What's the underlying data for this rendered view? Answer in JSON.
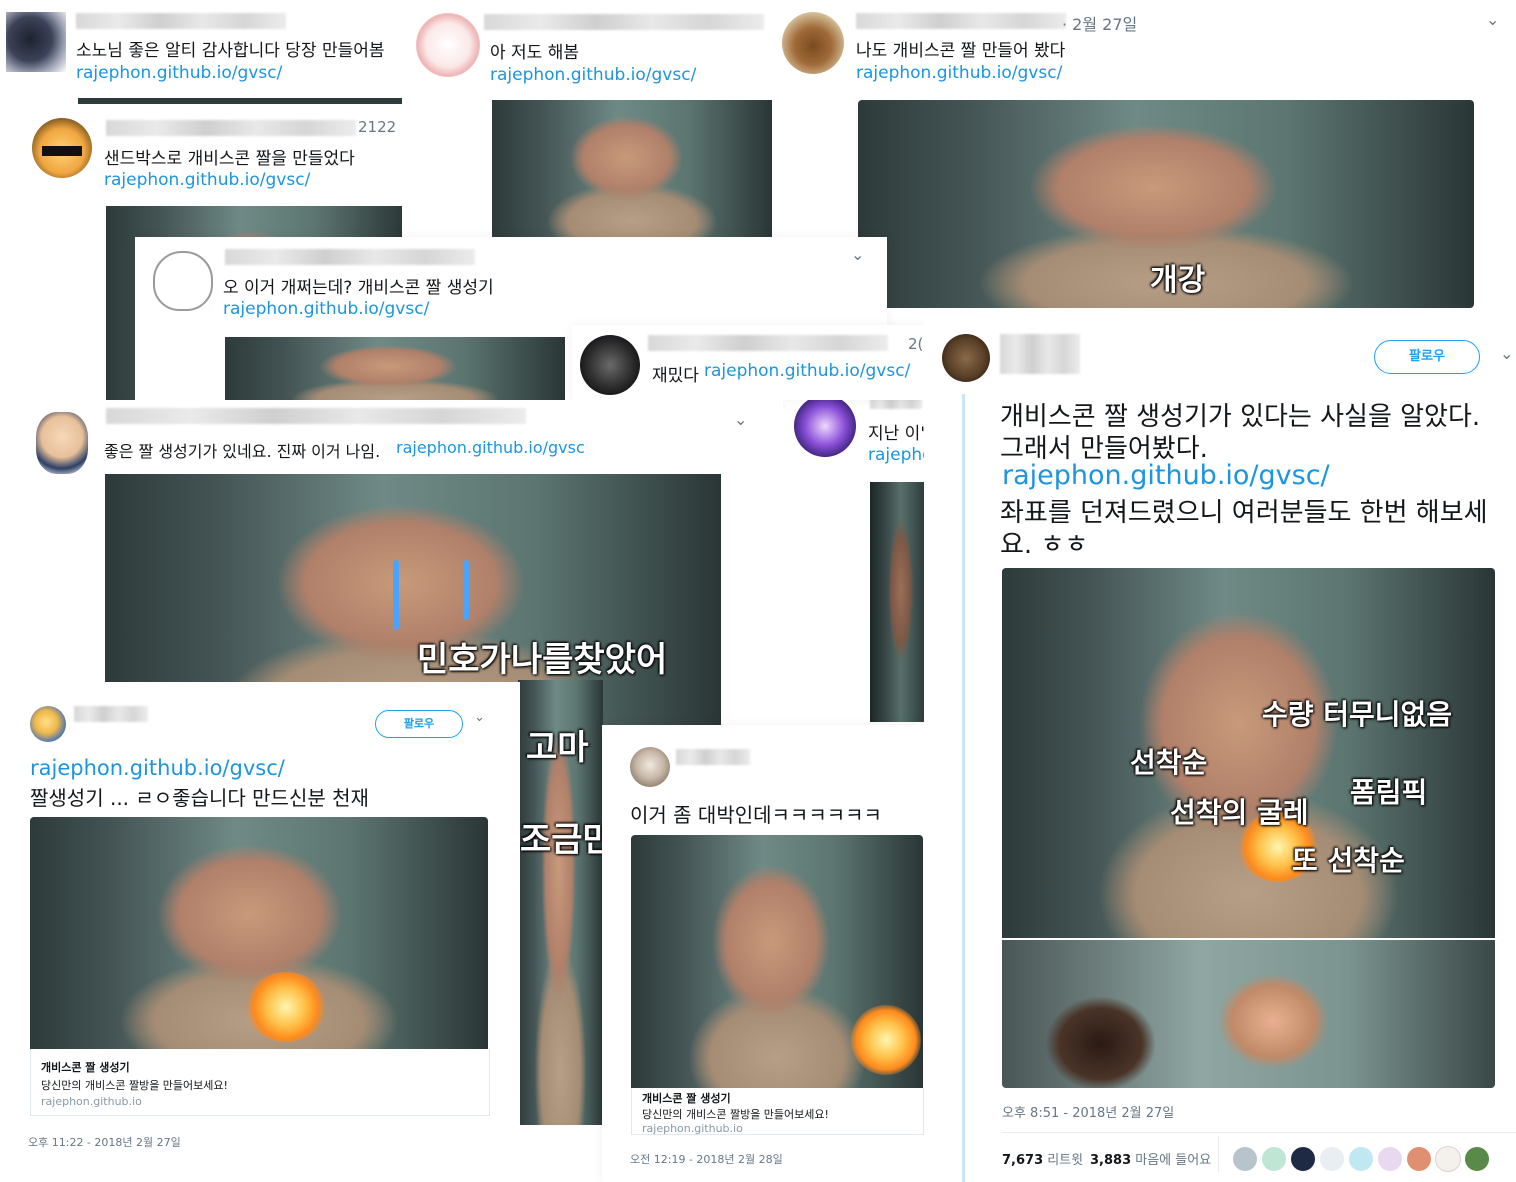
{
  "meta": {
    "colors": {
      "link": "#1b95e0",
      "follow": "#1da1f2",
      "text": "#14171a",
      "muted": "#657786"
    }
  },
  "t1": {
    "text": "소노님 좋은 알티 감사합니다 당장 만들어봄",
    "link": "rajephon.github.io/gvsc/"
  },
  "t2": {
    "text": "아 저도 해봄",
    "link": "rajephon.github.io/gvsc/"
  },
  "t3": {
    "date": "· 2월 27일",
    "text": "나도 개비스콘 짤 만들어 봤다",
    "link": "rajephon.github.io/gvsc/",
    "caption": "개강"
  },
  "t4": {
    "date": "2122",
    "text": "샌드박스로 개비스콘 짤을 만들었다",
    "link": "rajephon.github.io/gvsc/"
  },
  "t5": {
    "text": "오 이거 개쩌는데? 개비스콘 짤 생성기",
    "link": "rajephon.github.io/gvsc/"
  },
  "t6": {
    "date": "2(",
    "text": "재밌다",
    "link": "rajephon.github.io/gvsc/"
  },
  "t7": {
    "text": "지난 이'",
    "link": "rajepho"
  },
  "t8": {
    "text": "좋은 짤 생성기가 있네요. 진짜 이거 나임.",
    "link": "rajephon.github.io/gvsc",
    "captions": [
      "민호가나를찾았어",
      "고마",
      "조금만"
    ]
  },
  "t9": {
    "follow": "팔로우",
    "link": "rajephon.github.io/gvsc/",
    "text": "짤생성기 ... ㄹㅇ좋습니다 만드신분 천재",
    "card_title": "개비스콘 짤 생성기",
    "card_desc": "당신만의 개비스콘 짤방을 만들어보세요!",
    "card_domain": "rajephon.github.io",
    "timestamp": "오후 11:22 - 2018년 2월 27일"
  },
  "t10": {
    "text": "이거 좀 대박인데ㅋㅋㅋㅋㅋㅋ",
    "card_title": "개비스콘 짤 생성기",
    "card_desc": "당신만의 개비스콘 짤방을 만들어보세요!",
    "card_domain": "rajephon.github.io",
    "timestamp": "오전 12:19 - 2018년 2월 28일"
  },
  "t11": {
    "follow": "팔로우",
    "line1": "개비스콘 짤 생성기가 있다는 사실을 알았다.",
    "line2": "그래서 만들어봤다.",
    "link": "rajephon.github.io/gvsc/",
    "line3": "좌표를 던져드렸으니 여러분들도 한번 해보세",
    "line4": "요. ㅎㅎ",
    "captions": {
      "c1": "수량 터무니없음",
      "c2": "선착순",
      "c3": "폼림픽",
      "c4": "선착의 굴레",
      "c5": "또 선착순"
    },
    "timestamp": "오후 8:51 - 2018년 2월 27일",
    "retweets": "7,673",
    "retweets_label": "리트윗",
    "likes": "3,883",
    "likes_label": "마음에 들어요"
  }
}
